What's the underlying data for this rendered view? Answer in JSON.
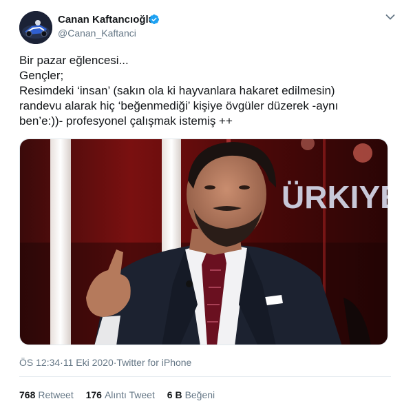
{
  "user": {
    "display_name": "Canan Kaftancıoğlu",
    "handle": "@Canan_Kaftanci",
    "verified": true
  },
  "tweet": {
    "lines": [
      "Bir pazar eğlencesi...",
      "Gençler;",
      "Resimdeki ‘insan’ (sakın ola ki hayvanlara hakaret edilmesin)",
      "randevu alarak hiç ‘beğenmediği’ kişiye övgüler düzerek -aynı",
      "ben’e:))- profesyonel çalışmak istemiş ++"
    ],
    "photo_caption_text": "ÜRKIYE"
  },
  "meta": {
    "time": "ÖS 12:34",
    "separator": " · ",
    "date": "11 Eki 2020",
    "source": "Twitter for iPhone"
  },
  "stats": {
    "retweets": {
      "count": "768",
      "label": "Retweet"
    },
    "quotes": {
      "count": "176",
      "label": "Alıntı Tweet"
    },
    "likes": {
      "count": "6 B",
      "label": "Beğeni"
    }
  },
  "icons": {
    "verified": "verified-badge-icon",
    "caret": "chevron-down-icon"
  },
  "colors": {
    "accent": "#1da1f2",
    "secondary_text": "#657786",
    "studio_red": "#8a1414"
  }
}
